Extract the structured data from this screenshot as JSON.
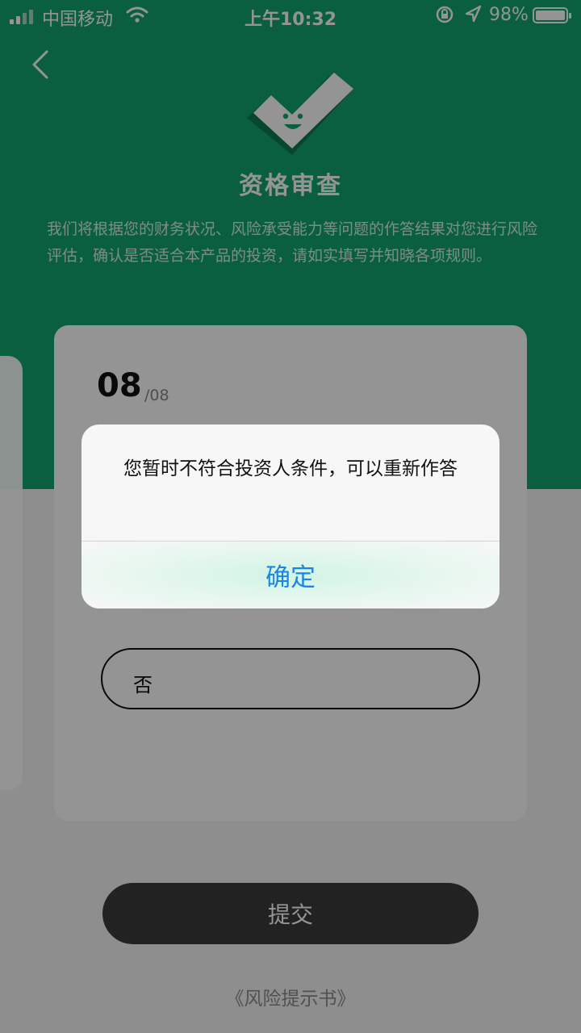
{
  "status_bar": {
    "carrier": "中国移动",
    "time": "上午10:32",
    "battery": "98%",
    "wifi_icon": "wifi-icon",
    "lock_icon": "rotation-lock-icon",
    "location_icon": "location-arrow-icon"
  },
  "header": {
    "back_icon": "chevron-left-icon",
    "title": "资格审查",
    "description": "我们将根据您的财务状况、风险承受能力等问题的作答结果对您进行风险评估，确认是否适合本产品的投资，请如实填写并知晓各项规则。"
  },
  "question": {
    "number": "08",
    "total": "/08"
  },
  "option": {
    "label": "否"
  },
  "submit_label": "提交",
  "risk_link": "《风险提示书》",
  "alert": {
    "message": "您暂时不符合投资人条件，可以重新作答",
    "confirm": "确定"
  },
  "colors": {
    "brand_green": "#12a56b",
    "alert_button_blue": "#1a86e8"
  }
}
